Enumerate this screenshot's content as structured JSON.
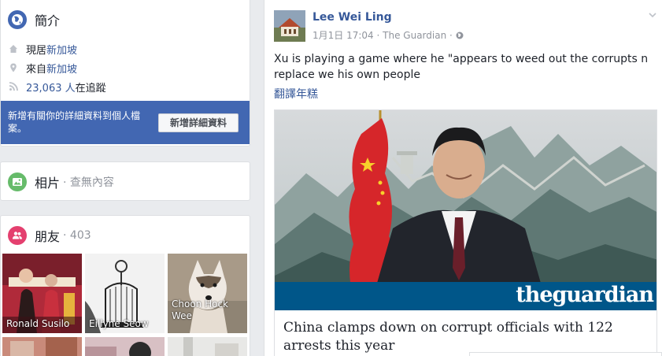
{
  "intro": {
    "title": "簡介",
    "lives_in_prefix": "現居",
    "lives_in_place": "新加坡",
    "from_prefix": "來自",
    "from_place": "新加坡",
    "followers_count": "23,063 人",
    "followers_suffix": "在追蹤",
    "add_info_text": "新增有關你的詳細資料到個人檔案。",
    "add_info_button": "新增詳細資料"
  },
  "photos": {
    "title": "相片",
    "subtitle": "· 查無內容"
  },
  "friends": {
    "title": "朋友",
    "count": "· 403",
    "items": [
      {
        "name": "Ronald Susilo"
      },
      {
        "name": "Eillyne Seow"
      },
      {
        "name": "Choon Hock Wee"
      }
    ]
  },
  "post": {
    "author": "Lee Wei Ling",
    "timestamp": "1月1日 17:04",
    "source": "The Guardian",
    "separator": "·",
    "text": "Xu is playing a game where he \"appears to weed out the corrupts n replace we his own people",
    "translate_label": "翻譯年糕",
    "link_title": "China clamps down on corrupt officials with 122 arrests this year",
    "brand": "theguardian"
  },
  "colors": {
    "brand_blue": "#4267b2",
    "link_blue": "#365899",
    "guardian_blue": "#005689",
    "friends_pink": "#e4406f",
    "photos_green": "#66bb6a"
  }
}
